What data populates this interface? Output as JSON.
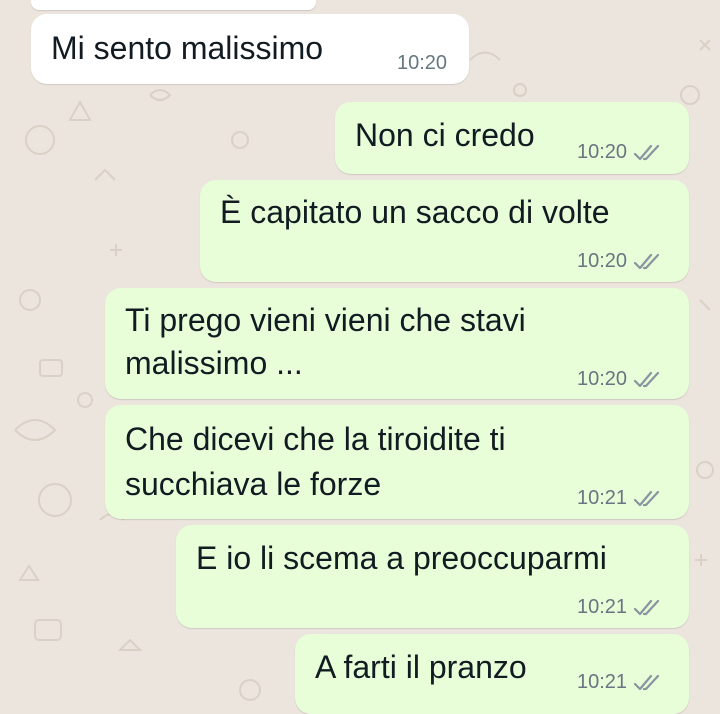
{
  "colors": {
    "background": "#ece5dd",
    "incoming_bubble": "#ffffff",
    "outgoing_bubble": "#e7fed8",
    "text": "#111b21",
    "meta_text": "#667781",
    "read_ticks": "#8696a0"
  },
  "messages": [
    {
      "direction": "incoming",
      "text": "Mi sento malissimo",
      "time": "10:20"
    },
    {
      "direction": "outgoing",
      "text": "Non ci credo",
      "time": "10:20",
      "status_icon": "double-check-icon"
    },
    {
      "direction": "outgoing",
      "text": "È capitato un sacco di volte",
      "time": "10:20",
      "status_icon": "double-check-icon"
    },
    {
      "direction": "outgoing",
      "text_lines": [
        "Ti prego vieni vieni che stavi",
        "malissimo ..."
      ],
      "time": "10:20",
      "status_icon": "double-check-icon"
    },
    {
      "direction": "outgoing",
      "text_lines": [
        "Che dicevi che la tiroidite ti",
        "succhiava le forze"
      ],
      "time": "10:21",
      "status_icon": "double-check-icon"
    },
    {
      "direction": "outgoing",
      "text": "E io li scema a preoccuparmi",
      "time": "10:21",
      "status_icon": "double-check-icon"
    },
    {
      "direction": "outgoing",
      "text": "A farti il pranzo",
      "time": "10:21",
      "status_icon": "double-check-icon"
    }
  ]
}
